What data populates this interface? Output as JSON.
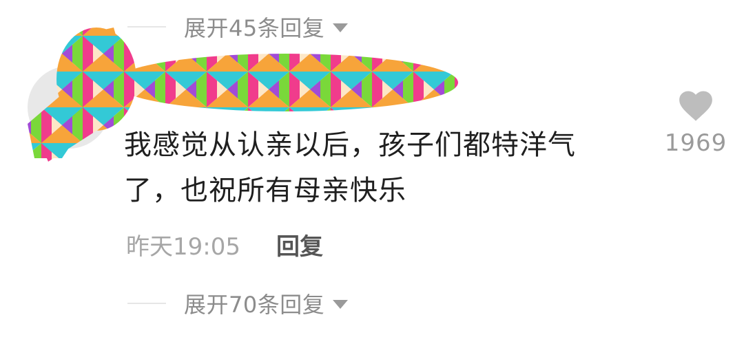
{
  "thread": {
    "expand_top_label": "展开45条回复",
    "expand_bottom_label": "展开70条回复"
  },
  "comment": {
    "line1": "我感觉从认亲以后，孩子们都特洋气",
    "line2": "了，也祝所有母亲快乐",
    "timestamp": "昨天19:05",
    "reply_label": "回复",
    "like_count": "1969"
  },
  "icons": {
    "heart": "heart-icon",
    "caret": "chevron-down-icon"
  },
  "colors": {
    "muted_text": "#8c8c8c",
    "heart_gray": "#bdbdbd"
  }
}
